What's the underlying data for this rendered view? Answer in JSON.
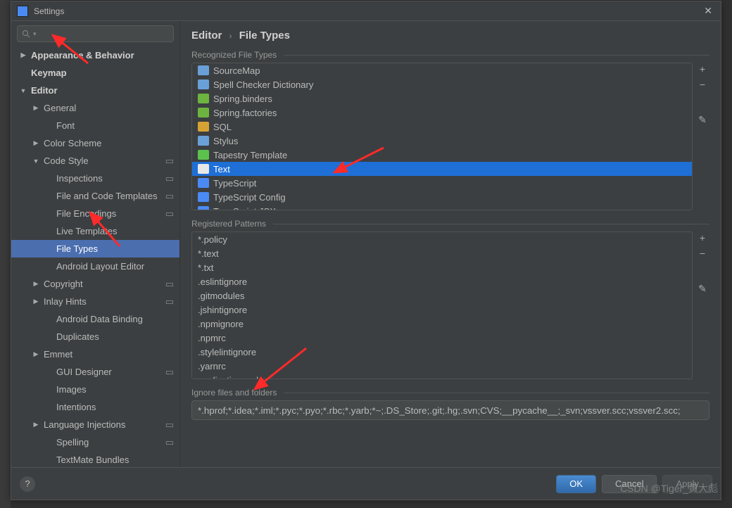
{
  "title": "Settings",
  "search_placeholder": "",
  "breadcrumb": {
    "a": "Editor",
    "b": "File Types"
  },
  "sidebar": {
    "items": [
      {
        "label": "Appearance & Behavior",
        "depth": 0,
        "arrow": "▶",
        "bold": true
      },
      {
        "label": "Keymap",
        "depth": 0,
        "bold": true
      },
      {
        "label": "Editor",
        "depth": 0,
        "arrow": "▼",
        "bold": true
      },
      {
        "label": "General",
        "depth": 1,
        "arrow": "▶"
      },
      {
        "label": "Font",
        "depth": 2
      },
      {
        "label": "Color Scheme",
        "depth": 1,
        "arrow": "▶"
      },
      {
        "label": "Code Style",
        "depth": 1,
        "arrow": "▼",
        "badge": true
      },
      {
        "label": "Inspections",
        "depth": 2,
        "badge": true
      },
      {
        "label": "File and Code Templates",
        "depth": 2,
        "badge": true
      },
      {
        "label": "File Encodings",
        "depth": 2,
        "badge": true
      },
      {
        "label": "Live Templates",
        "depth": 2
      },
      {
        "label": "File Types",
        "depth": 2,
        "selected": true
      },
      {
        "label": "Android Layout Editor",
        "depth": 2
      },
      {
        "label": "Copyright",
        "depth": 1,
        "arrow": "▶",
        "badge": true
      },
      {
        "label": "Inlay Hints",
        "depth": 1,
        "arrow": "▶",
        "badge": true
      },
      {
        "label": "Android Data Binding",
        "depth": 2
      },
      {
        "label": "Duplicates",
        "depth": 2
      },
      {
        "label": "Emmet",
        "depth": 1,
        "arrow": "▶"
      },
      {
        "label": "GUI Designer",
        "depth": 2,
        "badge": true
      },
      {
        "label": "Images",
        "depth": 2
      },
      {
        "label": "Intentions",
        "depth": 2
      },
      {
        "label": "Language Injections",
        "depth": 1,
        "arrow": "▶",
        "badge": true
      },
      {
        "label": "Spelling",
        "depth": 2,
        "badge": true
      },
      {
        "label": "TextMate Bundles",
        "depth": 2
      }
    ]
  },
  "recognized_label": "Recognized File Types",
  "file_types": [
    {
      "label": "SourceMap",
      "iconColor": "#6aa0d8"
    },
    {
      "label": "Spell Checker Dictionary",
      "iconColor": "#6aa0d8"
    },
    {
      "label": "Spring.binders",
      "iconColor": "#6db33f"
    },
    {
      "label": "Spring.factories",
      "iconColor": "#6db33f"
    },
    {
      "label": "SQL",
      "iconColor": "#d5a334"
    },
    {
      "label": "Stylus",
      "iconColor": "#6aa0d8"
    },
    {
      "label": "Tapestry Template",
      "iconColor": "#5bc24c"
    },
    {
      "label": "Text",
      "iconColor": "#e8e8e8",
      "selected": true
    },
    {
      "label": "TypeScript",
      "iconColor": "#4a8af4"
    },
    {
      "label": "TypeScript Config",
      "iconColor": "#4a8af4"
    },
    {
      "label": "TypeScript JSX",
      "iconColor": "#4a8af4"
    }
  ],
  "patterns_label": "Registered Patterns",
  "patterns": [
    "*.policy",
    "*.text",
    "*.txt",
    ".eslintignore",
    ".gitmodules",
    ".jshintignore",
    ".npmignore",
    ".npmrc",
    ".stylelintignore",
    ".yarnrc",
    "application.yml"
  ],
  "ignore_label": "Ignore files and folders",
  "ignore_value": "*.hprof;*.idea;*.iml;*.pyc;*.pyo;*.rbc;*.yarb;*~;.DS_Store;.git;.hg;.svn;CVS;__pycache__;_svn;vssver.scc;vssver2.scc;",
  "buttons": {
    "ok": "OK",
    "cancel": "Cancel",
    "apply": "Apply"
  },
  "tools": {
    "add": "+",
    "remove": "−",
    "edit": "✎"
  },
  "watermark": "CSDN @Tiger_黄大彪"
}
